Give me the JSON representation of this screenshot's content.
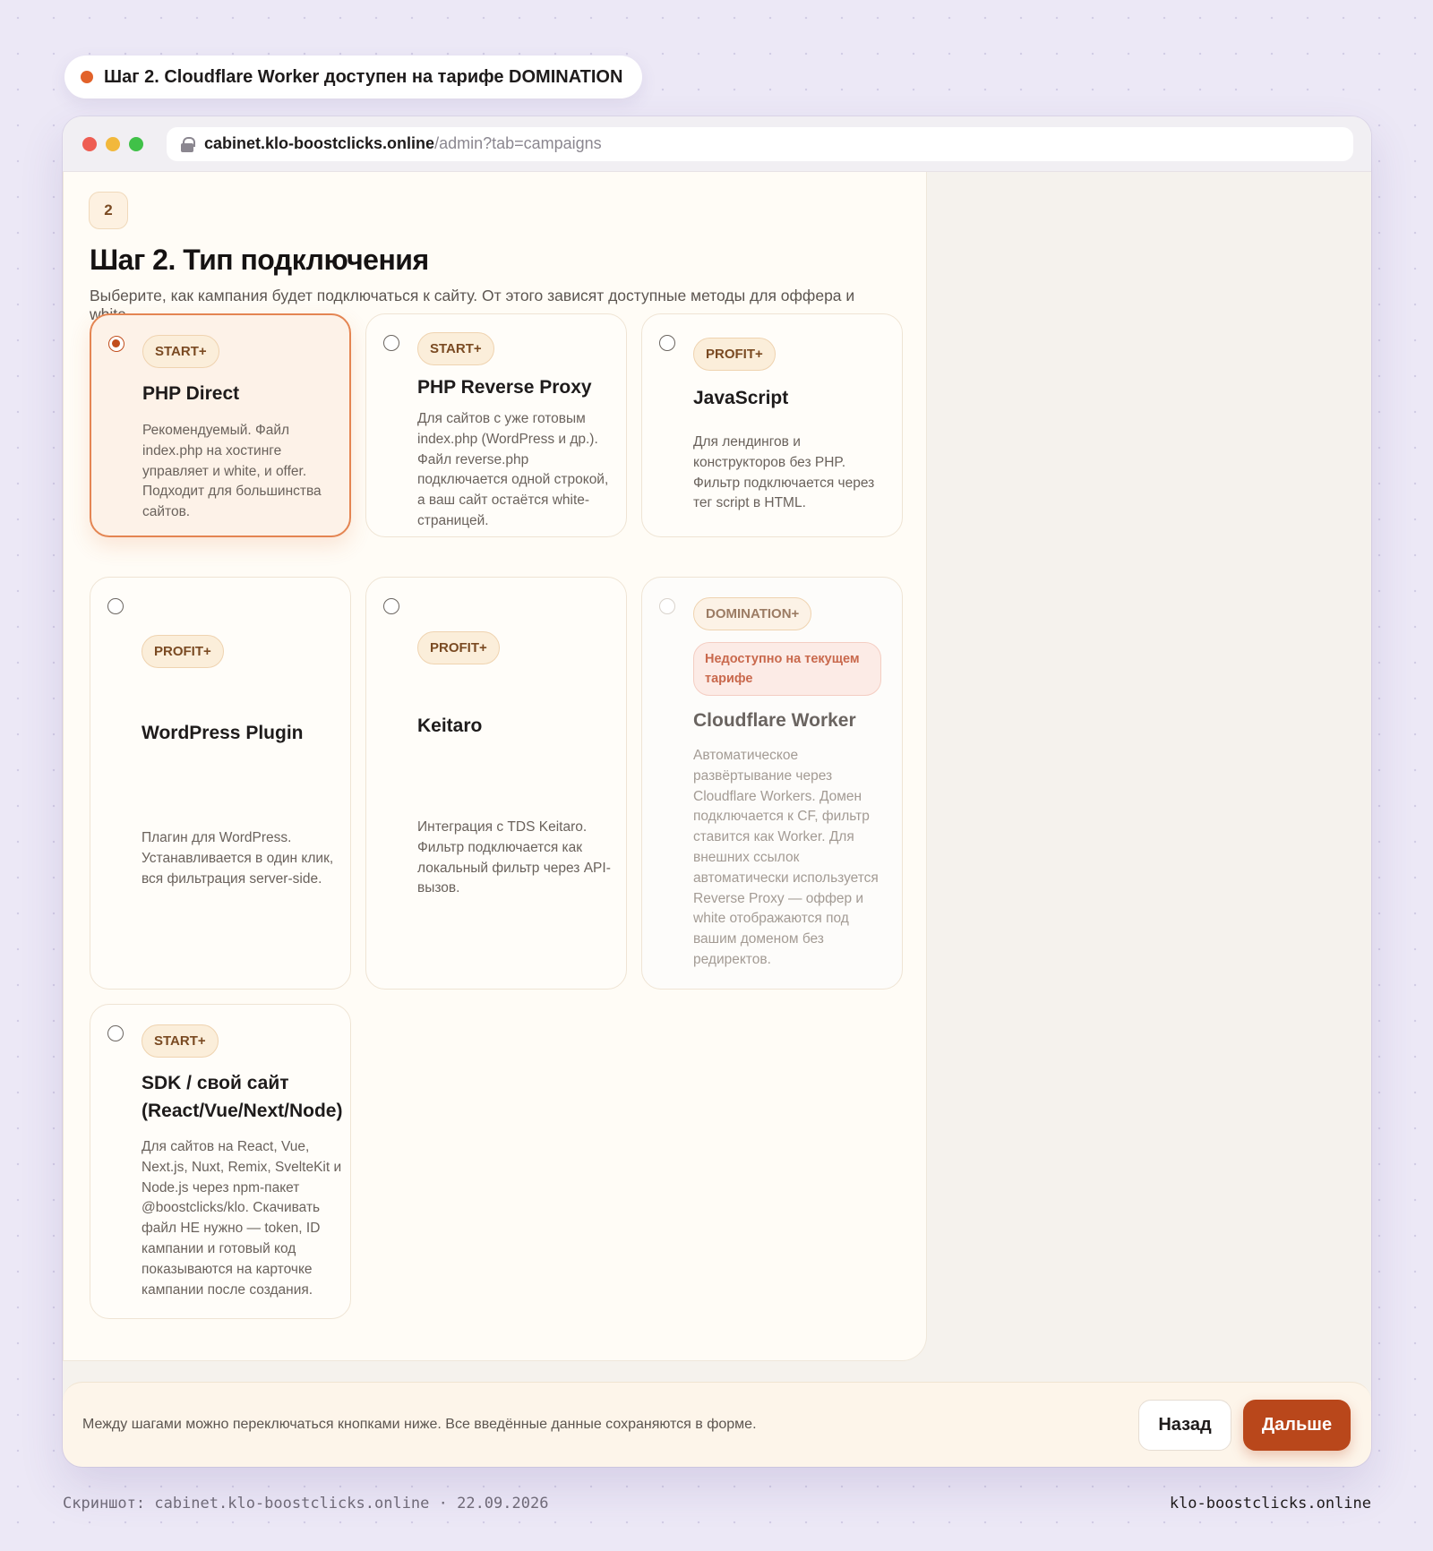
{
  "step_banner": {
    "text": "Шаг 2. Cloudflare Worker доступен на тарифе DOMINATION",
    "dot_color": "#e2622a"
  },
  "browser": {
    "url_host": "cabinet.klo-boostclicks.online",
    "url_path": "/admin?tab=campaigns"
  },
  "panel": {
    "step_number": "2",
    "title": "Шаг 2. Тип подключения",
    "lead": "Выберите, как кампания будет подключаться к сайту. От этого зависят доступные методы для оффера и white.",
    "options": [
      {
        "badge": "START+",
        "title": "PHP Direct",
        "desc": "Рекомендуемый. Файл index.php на хостинге управляет и white, и offer. Подходит для большинства сайтов.",
        "selected": true
      },
      {
        "badge": "START+",
        "title": "PHP Reverse Proxy",
        "desc": "Для сайтов с уже готовым index.php (WordPress и др.). Файл reverse.php подключается одной строкой, а ваш сайт остаётся white-страницей."
      },
      {
        "badge": "PROFIT+",
        "title": "JavaScript",
        "desc": "Для лендингов и конструкторов без PHP. Фильтр подключается через тег script в HTML."
      },
      {
        "badge": "PROFIT+",
        "title": "WordPress Plugin",
        "desc": "Плагин для WordPress. Устанавливается в один клик, вся фильтрация server-side."
      },
      {
        "badge": "PROFIT+",
        "title": "Keitaro",
        "desc": "Интеграция с TDS Keitaro. Фильтр подключается как локальный фильтр через API-вызов."
      },
      {
        "badge": "DOMINATION+",
        "warning": "Недоступно на текущем тарифе",
        "title": "Cloudflare Worker",
        "desc": "Автоматическое развёртывание через Cloudflare Workers. Домен подключается к CF, фильтр ставится как Worker. Для внешних ссылок автоматически используется Reverse Proxy — оффер и white отображаются под вашим доменом без редиректов.",
        "disabled": true
      },
      {
        "badge": "START+",
        "title": "SDK / свой сайт (React/Vue/Next/Node)",
        "desc": "Для сайтов на React, Vue, Next.js, Nuxt, Remix, SvelteKit и Node.js через npm-пакет @boostclicks/klo. Скачивать файл НЕ нужно — token, ID кампании и готовый код показываются на карточке кампании после создания."
      }
    ]
  },
  "footer": {
    "note": "Между шагами можно переключаться кнопками ниже. Все введённые данные сохраняются в форме.",
    "back_label": "Назад",
    "next_label": "Дальше"
  },
  "caption": {
    "left": "Скриншот: cabinet.klo-boostclicks.online · 22.09.2026",
    "right": "klo-boostclicks.online"
  },
  "colors": {
    "accent": "#b9471b",
    "selected_border": "#e48552",
    "badge_text": "#7a4a22",
    "warning_text": "#c9694d"
  }
}
